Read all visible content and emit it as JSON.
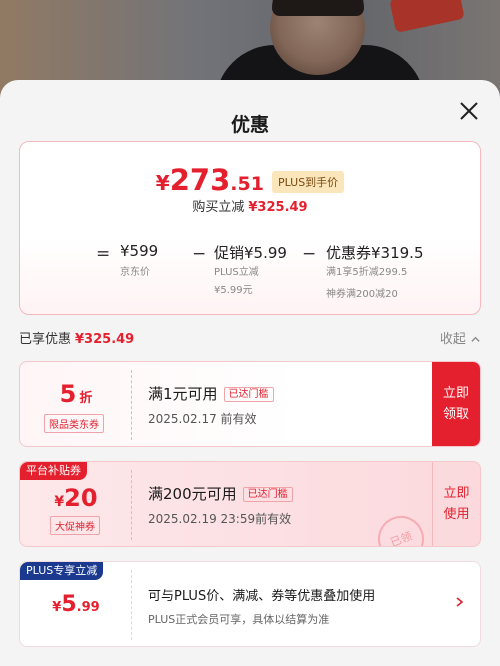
{
  "sheet": {
    "title": "优惠",
    "close_label": "关闭"
  },
  "summary": {
    "currency": "¥",
    "price_int": "273",
    "price_dec": ".51",
    "price_badge": "PLUS到手价",
    "buy_label": "购买立减",
    "buy_amount": "¥325.49",
    "calc": {
      "eq": "=",
      "minus": "−",
      "base_value": "¥599",
      "base_label": "京东价",
      "promo_value": "促销¥5.99",
      "promo_sub1": "PLUS立减",
      "promo_sub2": "¥5.99元",
      "coupon_value": "优惠券¥319.5",
      "coupon_sub1": "满1享5折减299.5",
      "coupon_sub2": "神券满200减20"
    }
  },
  "section": {
    "label": "已享优惠",
    "amount": "¥325.49",
    "collapse": "收起"
  },
  "coupons": [
    {
      "amount": "5",
      "unit": "折",
      "tag": "限品类东券",
      "condition": "满1元可用",
      "cond_tag": "已达门槛",
      "date": "2025.02.17 前有效",
      "action": "立即领取"
    },
    {
      "ribbon": "平台补贴券",
      "currency": "¥",
      "amount": "20",
      "tag": "大促神券",
      "condition": "满200元可用",
      "cond_tag": "已达门槛",
      "date": "2025.02.19 23:59前有效",
      "action": "立即使用",
      "stamp": "已领"
    },
    {
      "ribbon": "PLUS专享立减",
      "currency": "¥",
      "amount": "5",
      "dec": ".99",
      "desc1": "可与PLUS价、满减、券等优惠叠加使用",
      "desc2": "PLUS正式会员可享，具体以结算为准"
    }
  ],
  "colors": {
    "accent": "#e4202e",
    "plus_blue": "#1b3a8f",
    "sheet_bg": "#f4f4f4"
  }
}
